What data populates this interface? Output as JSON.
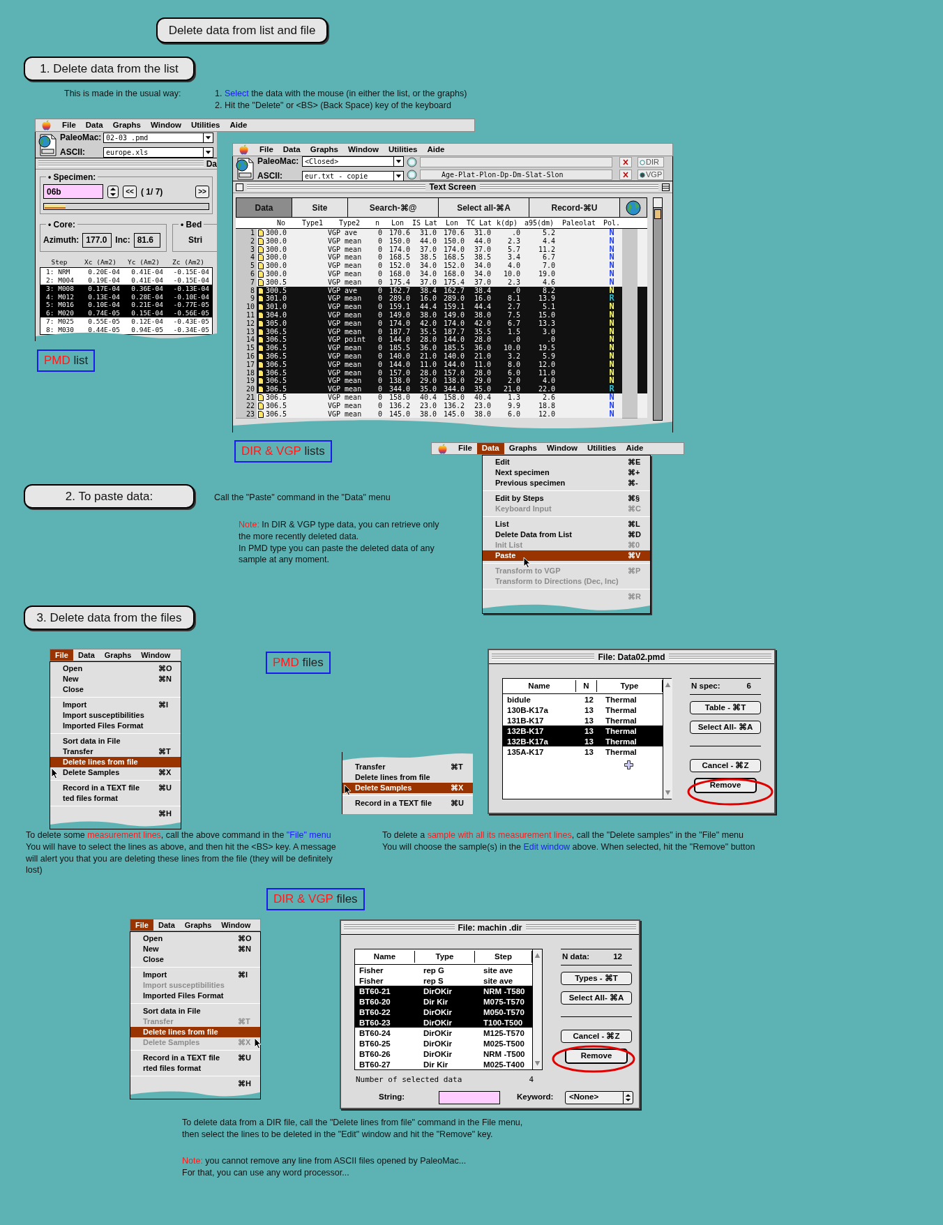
{
  "page_title": "Delete data from list and file",
  "section_1": {
    "heading": "1. Delete data from the list",
    "intro": "This is made in the usual way:",
    "steps": [
      {
        "marker": "1.",
        "segments": [
          {
            "text": "Select",
            "kind": "link"
          },
          {
            "text": " the data with the mouse (in either the list, or the graphs)",
            "kind": "plain"
          }
        ]
      },
      {
        "marker": "2.",
        "segments": [
          {
            "text": "Hit the \"Delete\" or <BS> (Back Space) key of the keyboard",
            "kind": "plain"
          }
        ]
      }
    ]
  },
  "pmd_window": {
    "menubar": [
      {
        "label": "File",
        "selected": false
      },
      {
        "label": "Data",
        "selected": false
      },
      {
        "label": "Graphs",
        "selected": false
      },
      {
        "label": "Window",
        "selected": false
      },
      {
        "label": "Utilities",
        "selected": false
      },
      {
        "label": "Aide",
        "selected": false
      }
    ],
    "paleomac_label": "PaleoMac:",
    "paleomac_file": "02-03 .pmd",
    "ascii_label": "ASCII:",
    "ascii_file": "europe.xls",
    "window_title": "Da",
    "specimen_label": "• Specimen:",
    "specimen": "06b",
    "prev_button": "<<",
    "position": "( 1/ 7)",
    "next_button": ">>",
    "progress": {
      "level": 0.13
    },
    "core_label": "• Core:",
    "azimuth_label": "Azimuth:",
    "azimuth": "177.0",
    "inc_label": "Inc:",
    "inc": "81.6",
    "bedding_label": "• Bed",
    "strike_label": "Stri",
    "columns": [
      "Step",
      "Xc (Am2)",
      "Yc (Am2)",
      "Zc (Am2)"
    ],
    "rows": [
      {
        "step": "1: NRM",
        "xc": "0.20E-04",
        "yc": "0.41E-04",
        "zc": "-0.15E-04",
        "selected": false
      },
      {
        "step": "2: M004",
        "xc": "0.19E-04",
        "yc": "0.41E-04",
        "zc": "-0.15E-04",
        "selected": false
      },
      {
        "step": "3: M008",
        "xc": "0.17E-04",
        "yc": "0.36E-04",
        "zc": "-0.13E-04",
        "selected": true
      },
      {
        "step": "4: M012",
        "xc": "0.13E-04",
        "yc": "0.28E-04",
        "zc": "-0.10E-04",
        "selected": true
      },
      {
        "step": "5: M016",
        "xc": "0.10E-04",
        "yc": "0.21E-04",
        "zc": "-0.77E-05",
        "selected": true
      },
      {
        "step": "6: M020",
        "xc": "0.74E-05",
        "yc": "0.15E-04",
        "zc": "-0.56E-05",
        "selected": true
      },
      {
        "step": "7: M025",
        "xc": "0.55E-05",
        "yc": "0.12E-04",
        "zc": "-0.43E-05",
        "selected": false
      },
      {
        "step": "8: M030",
        "xc": "0.44E-05",
        "yc": "0.94E-05",
        "zc": "-0.34E-05",
        "selected": false
      }
    ]
  },
  "pmd_list_label": [
    {
      "text": "PMD",
      "kind": "red"
    },
    {
      "text": " list",
      "kind": "plain"
    }
  ],
  "dir_window": {
    "menubar": [
      {
        "label": "File",
        "selected": false
      },
      {
        "label": "Data",
        "selected": false
      },
      {
        "label": "Graphs",
        "selected": false
      },
      {
        "label": "Window",
        "selected": false
      },
      {
        "label": "Utilities",
        "selected": false
      },
      {
        "label": "Aide",
        "selected": false
      }
    ],
    "paleomac_label": "PaleoMac:",
    "paleomac_file": "<Closed>",
    "ascii_label": "ASCII:",
    "ascii_file": "eur.txt - copie",
    "format": "Age-Plat-Plon-Dp-Dm-Slat-Slon",
    "options": [
      {
        "label": "DIR",
        "selected": false
      },
      {
        "label": "VGP",
        "selected": true
      }
    ],
    "window_title": "Text Screen",
    "tabs": [
      {
        "label": "Data",
        "selected": true
      },
      {
        "label": "Site",
        "selected": false
      },
      {
        "label": "Search-⌘@",
        "selected": false
      },
      {
        "label": "Select all-⌘A",
        "selected": false
      },
      {
        "label": "Record-⌘U",
        "selected": false
      }
    ],
    "columns": [
      "No",
      "Type1",
      "Type2",
      "n",
      "Lon",
      "IS Lat",
      "Lon",
      "TC Lat",
      "k(dp)",
      "a95(dm)",
      "Paleolat",
      "Pol."
    ],
    "rows": [
      {
        "index": "1",
        "no": "300.0",
        "type2": "VGP ave",
        "n": "0",
        "lon_is": "170.6",
        "lat_is": "31.0",
        "lon_tc": "170.6",
        "lat_tc": "31.0",
        "k": ".0",
        "a95": "5.2",
        "pol": "N",
        "color": "#1a3cff",
        "selected": false
      },
      {
        "index": "2",
        "no": "300.0",
        "type2": "VGP mean",
        "n": "0",
        "lon_is": "150.0",
        "lat_is": "44.0",
        "lon_tc": "150.0",
        "lat_tc": "44.0",
        "k": "2.3",
        "a95": "4.4",
        "pol": "N",
        "color": "#1a3cff",
        "selected": false
      },
      {
        "index": "3",
        "no": "300.0",
        "type2": "VGP mean",
        "n": "0",
        "lon_is": "174.0",
        "lat_is": "37.0",
        "lon_tc": "174.0",
        "lat_tc": "37.0",
        "k": "5.7",
        "a95": "11.2",
        "pol": "N",
        "color": "#1a3cff",
        "selected": false
      },
      {
        "index": "4",
        "no": "300.0",
        "type2": "VGP mean",
        "n": "0",
        "lon_is": "168.5",
        "lat_is": "38.5",
        "lon_tc": "168.5",
        "lat_tc": "38.5",
        "k": "3.4",
        "a95": "6.7",
        "pol": "N",
        "color": "#1a3cff",
        "selected": false
      },
      {
        "index": "5",
        "no": "300.0",
        "type2": "VGP mean",
        "n": "0",
        "lon_is": "152.0",
        "lat_is": "34.0",
        "lon_tc": "152.0",
        "lat_tc": "34.0",
        "k": "4.0",
        "a95": "7.0",
        "pol": "N",
        "color": "#1a3cff",
        "selected": false
      },
      {
        "index": "6",
        "no": "300.0",
        "type2": "VGP mean",
        "n": "0",
        "lon_is": "168.0",
        "lat_is": "34.0",
        "lon_tc": "168.0",
        "lat_tc": "34.0",
        "k": "10.0",
        "a95": "19.0",
        "pol": "N",
        "color": "#1a3cff",
        "selected": false
      },
      {
        "index": "7",
        "no": "300.5",
        "type2": "VGP mean",
        "n": "0",
        "lon_is": "175.4",
        "lat_is": "37.0",
        "lon_tc": "175.4",
        "lat_tc": "37.0",
        "k": "2.3",
        "a95": "4.6",
        "pol": "N",
        "color": "#1a3cff",
        "selected": false
      },
      {
        "index": "8",
        "no": "300.5",
        "type2": "VGP ave",
        "n": "0",
        "lon_is": "162.7",
        "lat_is": "38.4",
        "lon_tc": "162.7",
        "lat_tc": "38.4",
        "k": ".0",
        "a95": "8.2",
        "pol": "N",
        "color": "#ffff66",
        "selected": true
      },
      {
        "index": "9",
        "no": "301.0",
        "type2": "VGP mean",
        "n": "0",
        "lon_is": "289.0",
        "lat_is": "16.0",
        "lon_tc": "289.0",
        "lat_tc": "16.0",
        "k": "8.1",
        "a95": "13.9",
        "pol": "R",
        "color": "#33bbcc",
        "selected": true
      },
      {
        "index": "10",
        "no": "301.0",
        "type2": "VGP mean",
        "n": "0",
        "lon_is": "159.1",
        "lat_is": "44.4",
        "lon_tc": "159.1",
        "lat_tc": "44.4",
        "k": "2.7",
        "a95": "5.1",
        "pol": "N",
        "color": "#ffff66",
        "selected": true
      },
      {
        "index": "11",
        "no": "304.0",
        "type2": "VGP mean",
        "n": "0",
        "lon_is": "149.0",
        "lat_is": "38.0",
        "lon_tc": "149.0",
        "lat_tc": "38.0",
        "k": "7.5",
        "a95": "15.0",
        "pol": "N",
        "color": "#ffff66",
        "selected": true
      },
      {
        "index": "12",
        "no": "305.0",
        "type2": "VGP mean",
        "n": "0",
        "lon_is": "174.0",
        "lat_is": "42.0",
        "lon_tc": "174.0",
        "lat_tc": "42.0",
        "k": "6.7",
        "a95": "13.3",
        "pol": "N",
        "color": "#ffff66",
        "selected": true
      },
      {
        "index": "13",
        "no": "306.5",
        "type2": "VGP mean",
        "n": "0",
        "lon_is": "187.7",
        "lat_is": "35.5",
        "lon_tc": "187.7",
        "lat_tc": "35.5",
        "k": "1.5",
        "a95": "3.0",
        "pol": "N",
        "color": "#ffff66",
        "selected": true
      },
      {
        "index": "14",
        "no": "306.5",
        "type2": "VGP point",
        "n": "0",
        "lon_is": "144.0",
        "lat_is": "28.0",
        "lon_tc": "144.0",
        "lat_tc": "28.0",
        "k": ".0",
        "a95": ".0",
        "pol": "N",
        "color": "#ffff66",
        "selected": true
      },
      {
        "index": "15",
        "no": "306.5",
        "type2": "VGP mean",
        "n": "0",
        "lon_is": "185.5",
        "lat_is": "36.0",
        "lon_tc": "185.5",
        "lat_tc": "36.0",
        "k": "10.0",
        "a95": "19.5",
        "pol": "N",
        "color": "#ffff66",
        "selected": true
      },
      {
        "index": "16",
        "no": "306.5",
        "type2": "VGP mean",
        "n": "0",
        "lon_is": "140.0",
        "lat_is": "21.0",
        "lon_tc": "140.0",
        "lat_tc": "21.0",
        "k": "3.2",
        "a95": "5.9",
        "pol": "N",
        "color": "#ffff66",
        "selected": true
      },
      {
        "index": "17",
        "no": "306.5",
        "type2": "VGP mean",
        "n": "0",
        "lon_is": "144.0",
        "lat_is": "11.0",
        "lon_tc": "144.0",
        "lat_tc": "11.0",
        "k": "8.0",
        "a95": "12.0",
        "pol": "N",
        "color": "#ffff66",
        "selected": true
      },
      {
        "index": "18",
        "no": "306.5",
        "type2": "VGP mean",
        "n": "0",
        "lon_is": "157.0",
        "lat_is": "28.0",
        "lon_tc": "157.0",
        "lat_tc": "28.0",
        "k": "6.0",
        "a95": "11.0",
        "pol": "N",
        "color": "#ffff66",
        "selected": true
      },
      {
        "index": "19",
        "no": "306.5",
        "type2": "VGP mean",
        "n": "0",
        "lon_is": "138.0",
        "lat_is": "29.0",
        "lon_tc": "138.0",
        "lat_tc": "29.0",
        "k": "2.0",
        "a95": "4.0",
        "pol": "N",
        "color": "#ffff66",
        "selected": true
      },
      {
        "index": "20",
        "no": "306.5",
        "type2": "VGP mean",
        "n": "0",
        "lon_is": "344.0",
        "lat_is": "35.0",
        "lon_tc": "344.0",
        "lat_tc": "35.0",
        "k": "21.0",
        "a95": "22.0",
        "pol": "R",
        "color": "#33bbcc",
        "selected": true
      },
      {
        "index": "21",
        "no": "306.5",
        "type2": "VGP mean",
        "n": "0",
        "lon_is": "158.0",
        "lat_is": "40.4",
        "lon_tc": "158.0",
        "lat_tc": "40.4",
        "k": "1.3",
        "a95": "2.6",
        "pol": "N",
        "color": "#1a3cff",
        "selected": false
      },
      {
        "index": "22",
        "no": "306.5",
        "type2": "VGP mean",
        "n": "0",
        "lon_is": "136.2",
        "lat_is": "23.0",
        "lon_tc": "136.2",
        "lat_tc": "23.0",
        "k": "9.9",
        "a95": "18.8",
        "pol": "N",
        "color": "#1a3cff",
        "selected": false
      },
      {
        "index": "23",
        "no": "306.5",
        "type2": "VGP mean",
        "n": "0",
        "lon_is": "145.0",
        "lat_is": "38.0",
        "lon_tc": "145.0",
        "lat_tc": "38.0",
        "k": "6.0",
        "a95": "12.0",
        "pol": "N",
        "color": "#1a3cff",
        "selected": false
      }
    ]
  },
  "dir_list_label": [
    {
      "text": "DIR & VGP",
      "kind": "red"
    },
    {
      "text": " lists",
      "kind": "plain"
    }
  ],
  "section_2": {
    "heading": "2. To paste data:",
    "text": "Call the \"Paste\" command in the \"Data\" menu",
    "note": [
      [
        {
          "text": "Note:",
          "kind": "red"
        },
        {
          "text": " In DIR & VGP type data, you can retrieve only",
          "kind": "plain"
        }
      ],
      [
        {
          "text": "the more recently deleted data.",
          "kind": "plain"
        }
      ],
      [
        {
          "text": "In PMD type you can paste the deleted data of any",
          "kind": "plain"
        }
      ],
      [
        {
          "text": "sample at any moment.",
          "kind": "plain"
        }
      ]
    ]
  },
  "data_menu": {
    "menubar": [
      {
        "label": "File",
        "selected": false
      },
      {
        "label": "Data",
        "selected": true
      },
      {
        "label": "Graphs",
        "selected": false
      },
      {
        "label": "Window",
        "selected": false
      },
      {
        "label": "Utilities",
        "selected": false
      },
      {
        "label": "Aide",
        "selected": false
      }
    ],
    "groups": [
      [
        {
          "label": "Edit",
          "shortcut": "⌘E",
          "selected": false,
          "disabled": false
        },
        {
          "label": "Next specimen",
          "shortcut": "⌘+",
          "selected": false,
          "disabled": false
        },
        {
          "label": "Previous specimen",
          "shortcut": "⌘-",
          "selected": false,
          "disabled": false
        }
      ],
      [
        {
          "label": "Edit by Steps",
          "shortcut": "⌘§",
          "selected": false,
          "disabled": false
        },
        {
          "label": "Keyboard Input",
          "shortcut": "⌘C",
          "selected": false,
          "disabled": true
        }
      ],
      [
        {
          "label": "List",
          "shortcut": "⌘L",
          "selected": false,
          "disabled": false
        },
        {
          "label": "Delete Data from List",
          "shortcut": "⌘D",
          "selected": false,
          "disabled": false
        },
        {
          "label": "Init List",
          "shortcut": "⌘0",
          "selected": false,
          "disabled": true
        },
        {
          "label": "Paste",
          "shortcut": "⌘V",
          "selected": true,
          "disabled": false
        }
      ],
      [
        {
          "label": "Transform to VGP",
          "shortcut": "⌘P",
          "selected": false,
          "disabled": true
        },
        {
          "label": "Transform to Directions (Dec, Inc)",
          "selected": false,
          "disabled": true
        }
      ],
      [
        {
          "shortcut": "⌘R",
          "selected": false,
          "disabled": true
        }
      ]
    ]
  },
  "section_3": {
    "heading": "3. Delete data from the files",
    "pmd_file_menu": {
      "menubar": [
        {
          "label": "File",
          "selected": true
        },
        {
          "label": "Data",
          "selected": false
        },
        {
          "label": "Graphs",
          "selected": false
        },
        {
          "label": "Window",
          "selected": false
        }
      ],
      "groups": [
        [
          {
            "label": "Open",
            "shortcut": "⌘O",
            "selected": false,
            "disabled": false
          },
          {
            "label": "New",
            "shortcut": "⌘N",
            "selected": false,
            "disabled": false
          },
          {
            "label": "Close",
            "selected": false,
            "disabled": false
          }
        ],
        [
          {
            "label": "Import",
            "shortcut": "⌘I",
            "selected": false,
            "disabled": false
          },
          {
            "label": "Import susceptibilities",
            "selected": false,
            "disabled": false
          },
          {
            "label": "Imported Files Format",
            "selected": false,
            "disabled": false
          }
        ],
        [
          {
            "label": "Sort data in File",
            "selected": false,
            "disabled": false
          },
          {
            "label": "Transfer",
            "shortcut": "⌘T",
            "selected": false,
            "disabled": false
          },
          {
            "label": "Delete lines from file",
            "selected": true,
            "disabled": false
          },
          {
            "label": "Delete Samples",
            "shortcut": "⌘X",
            "selected": false,
            "disabled": false
          }
        ],
        [
          {
            "label": "Record in a TEXT file",
            "shortcut": "⌘U",
            "selected": false,
            "disabled": false
          },
          {
            "label": "ted files format",
            "selected": false,
            "disabled": false
          }
        ],
        [
          {
            "shortcut": "⌘H",
            "selected": false,
            "disabled": false
          }
        ]
      ]
    },
    "pmd_files_label": [
      {
        "text": "PMD",
        "kind": "red"
      },
      {
        "text": " files",
        "kind": "plain"
      }
    ],
    "pmd_partial_menu": {
      "groups": [
        [
          {
            "label": "Transfer",
            "shortcut": "⌘T",
            "selected": false,
            "disabled": false
          },
          {
            "label": "Delete lines from file",
            "selected": false,
            "disabled": false
          },
          {
            "label": "Delete Samples",
            "shortcut": "⌘X",
            "selected": true,
            "disabled": false
          }
        ],
        [
          {
            "label": "Record in a TEXT file",
            "shortcut": "⌘U",
            "selected": false,
            "disabled": false
          }
        ]
      ]
    },
    "pmd_dialog": {
      "title": "File: Data02.pmd",
      "columns": [
        "Name",
        "N",
        "Type"
      ],
      "rows": [
        {
          "name": "bidule",
          "n": "12",
          "type": "Thermal",
          "selected": false
        },
        {
          "name": "130B-K17a",
          "n": "13",
          "type": "Thermal",
          "selected": false
        },
        {
          "name": "131B-K17",
          "n": "13",
          "type": "Thermal",
          "selected": false
        },
        {
          "name": "132B-K17",
          "n": "13",
          "type": "Thermal",
          "selected": true
        },
        {
          "name": "132B-K17a",
          "n": "13",
          "type": "Thermal",
          "selected": true
        },
        {
          "name": "135A-K17",
          "n": "13",
          "type": "Thermal",
          "selected": false
        }
      ],
      "count_label": "N spec:",
      "count": "6",
      "buttons": [
        "Table - ⌘T",
        "Select All- ⌘A"
      ],
      "cancel_button": "Cancel - ⌘Z",
      "remove_button": "Remove"
    },
    "pmd_lines_text": [
      [
        {
          "text": "To delete some ",
          "kind": "plain"
        },
        {
          "text": "measurement lines",
          "kind": "red"
        },
        {
          "text": ", call the above command in the ",
          "kind": "plain"
        },
        {
          "text": "\"File\" menu",
          "kind": "link"
        }
      ],
      [
        {
          "text": "You will have to select the lines as above, and then hit the <BS> key. A message",
          "kind": "plain"
        }
      ],
      [
        {
          "text": "will alert you that you are deleting these lines from the file (they will be definitely",
          "kind": "plain"
        }
      ],
      [
        {
          "text": "lost)",
          "kind": "plain"
        }
      ]
    ],
    "pmd_samples_text": [
      [
        {
          "text": "To delete a ",
          "kind": "plain"
        },
        {
          "text": "sample with all its measurement lines",
          "kind": "red"
        },
        {
          "text": ", call the \"Delete samples\" in the \"File\" menu",
          "kind": "plain"
        }
      ],
      [
        {
          "text": "You will choose the sample(s) in the ",
          "kind": "plain"
        },
        {
          "text": "Edit window",
          "kind": "link"
        },
        {
          "text": " above. When selected, hit the \"Remove\" button",
          "kind": "plain"
        }
      ]
    ],
    "dir_files_label": [
      {
        "text": "DIR & VGP",
        "kind": "red"
      },
      {
        "text": " files",
        "kind": "plain"
      }
    ],
    "dir_file_menu": {
      "menubar": [
        {
          "label": "File",
          "selected": true
        },
        {
          "label": "Data",
          "selected": false
        },
        {
          "label": "Graphs",
          "selected": false
        },
        {
          "label": "Window",
          "selected": false
        }
      ],
      "groups": [
        [
          {
            "label": "Open",
            "shortcut": "⌘O",
            "selected": false,
            "disabled": false
          },
          {
            "label": "New",
            "shortcut": "⌘N",
            "selected": false,
            "disabled": false
          },
          {
            "label": "Close",
            "selected": false,
            "disabled": false
          }
        ],
        [
          {
            "label": "Import",
            "shortcut": "⌘I",
            "selected": false,
            "disabled": false
          },
          {
            "label": "Import susceptibilities",
            "selected": false,
            "disabled": true
          },
          {
            "label": "Imported Files Format",
            "selected": false,
            "disabled": false
          }
        ],
        [
          {
            "label": "Sort data in File",
            "selected": false,
            "disabled": false
          },
          {
            "label": "Transfer",
            "shortcut": "⌘T",
            "selected": false,
            "disabled": true
          },
          {
            "label": "Delete lines from file",
            "selected": true,
            "disabled": false
          },
          {
            "label": "Delete Samples",
            "shortcut": "⌘X",
            "selected": false,
            "disabled": true
          }
        ],
        [
          {
            "label": "Record in a TEXT file",
            "shortcut": "⌘U",
            "selected": false,
            "disabled": false
          },
          {
            "label": "rted files format",
            "selected": false,
            "disabled": false
          }
        ],
        [
          {
            "shortcut": "⌘H",
            "selected": false,
            "disabled": false
          }
        ]
      ]
    },
    "dir_dialog": {
      "title": "File:  machin .dir",
      "columns": [
        "Name",
        "Type",
        "Step"
      ],
      "rows": [
        {
          "name": "Fisher",
          "type": "rep G",
          "step": "site ave",
          "selected": false
        },
        {
          "name": "Fisher",
          "type": "rep S",
          "step": "site ave",
          "selected": false
        },
        {
          "name": "BT60-21",
          "type": "DirOKir",
          "step": "NRM -T580",
          "selected": true
        },
        {
          "name": "BT60-20",
          "type": "Dir Kir",
          "step": "M075-T570",
          "selected": true
        },
        {
          "name": "BT60-22",
          "type": "DirOKir",
          "step": "M050-T570",
          "selected": true
        },
        {
          "name": "BT60-23",
          "type": "DirOKir",
          "step": "T100-T500",
          "selected": true
        },
        {
          "name": "BT60-24",
          "type": "DirOKir",
          "step": "M125-T570",
          "selected": false
        },
        {
          "name": "BT60-25",
          "type": "DirOKir",
          "step": "M025-T500",
          "selected": false
        },
        {
          "name": "BT60-26",
          "type": "DirOKir",
          "step": "NRM -T500",
          "selected": false
        },
        {
          "name": "BT60-27",
          "type": "Dir Kir",
          "step": "M025-T400",
          "selected": false
        }
      ],
      "count_label": "N data:",
      "count": "12",
      "buttons": [
        "Types - ⌘T",
        "Select All- ⌘A"
      ],
      "cancel_button": "Cancel - ⌘Z",
      "remove_button": "Remove",
      "selected_label": "Number of selected data",
      "selected_count": "4",
      "string_label": "String:",
      "keyword_label": "Keyword:",
      "keyword": "<None>"
    },
    "dir_text": [
      [
        {
          "text": "To delete data from a DIR file, call the \"Delete lines from file\" command in the File menu,",
          "kind": "plain"
        }
      ],
      [
        {
          "text": "then select the lines to be deleted in the \"Edit\" window and hit the \"Remove\" key.",
          "kind": "plain"
        }
      ]
    ],
    "dir_note": [
      [
        {
          "text": "Note:",
          "kind": "red"
        },
        {
          "text": " you cannot remove any line from ASCII files opened by PaleoMac...",
          "kind": "plain"
        }
      ],
      [
        {
          "text": "For that, you can use any word processor...",
          "kind": "plain"
        }
      ]
    ]
  }
}
